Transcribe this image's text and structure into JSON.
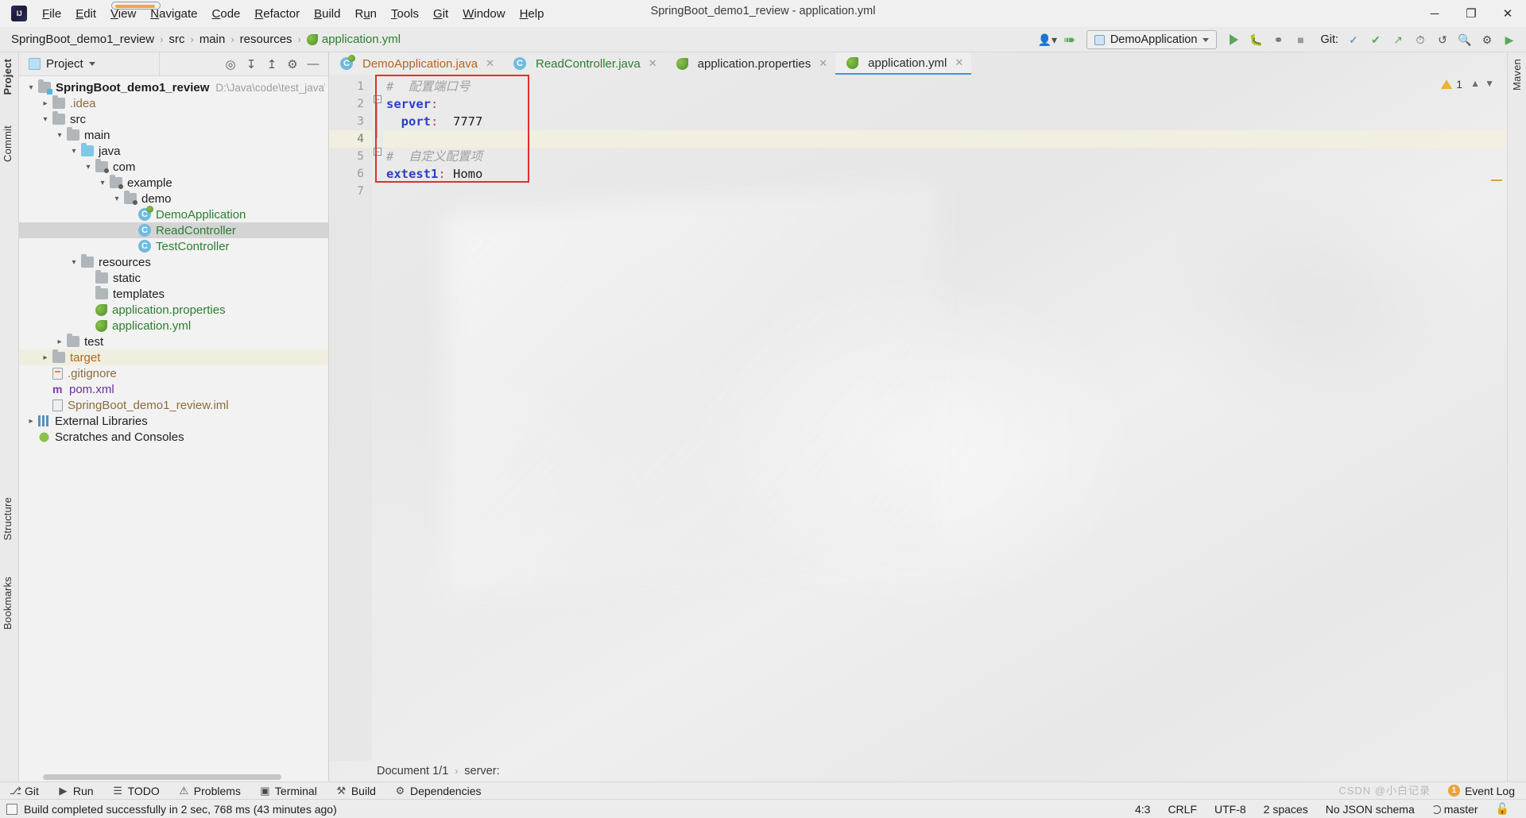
{
  "window": {
    "title": "SpringBoot_demo1_review - application.yml",
    "controls": {
      "minimize": "─",
      "maximize": "❐",
      "close": "✕"
    }
  },
  "menu": {
    "logo": "IJ",
    "items": [
      {
        "label": "File",
        "mnemonic": "F"
      },
      {
        "label": "Edit",
        "mnemonic": "E"
      },
      {
        "label": "View",
        "mnemonic": "V"
      },
      {
        "label": "Navigate",
        "mnemonic": "N",
        "highlighted": true
      },
      {
        "label": "Code",
        "mnemonic": "C"
      },
      {
        "label": "Refactor",
        "mnemonic": "R"
      },
      {
        "label": "Build",
        "mnemonic": "B"
      },
      {
        "label": "Run",
        "mnemonic": "u"
      },
      {
        "label": "Tools",
        "mnemonic": "T"
      },
      {
        "label": "Git",
        "mnemonic": "G"
      },
      {
        "label": "Window",
        "mnemonic": "W"
      },
      {
        "label": "Help",
        "mnemonic": "H"
      }
    ]
  },
  "navbar": {
    "crumbs": [
      "SpringBoot_demo1_review",
      "src",
      "main",
      "resources"
    ],
    "leaf": "application.yml",
    "separator": "›",
    "run_config": "DemoApplication",
    "git_label": "Git:",
    "icons": [
      "user-dropdown-icon",
      "update-project-icon",
      "run-icon",
      "debug-icon",
      "run-with-coverage-icon",
      "stop-icon",
      "git-commit-icon",
      "git-check-icon",
      "git-push-icon",
      "history-icon",
      "undo-icon",
      "search-icon",
      "settings-icon",
      "ide-icon"
    ]
  },
  "left_strip": {
    "tabs": [
      "Project",
      "Commit",
      "Structure",
      "Bookmarks"
    ],
    "selected": "Project"
  },
  "right_strip": {
    "tabs": [
      "Maven"
    ]
  },
  "project_panel": {
    "title": "Project",
    "actions": [
      "locate-icon",
      "expand-all-icon",
      "collapse-all-icon",
      "settings-icon",
      "hide-icon"
    ],
    "tree": [
      {
        "indent": 0,
        "arrow": "down",
        "icon": "module-folder",
        "label": "SpringBoot_demo1_review",
        "bold": true,
        "path": "D:\\Java\\code\\test_java\\SpringB…"
      },
      {
        "indent": 1,
        "arrow": "right",
        "icon": "folder",
        "label": ".idea",
        "color": "brown"
      },
      {
        "indent": 1,
        "arrow": "down",
        "icon": "folder",
        "label": "src"
      },
      {
        "indent": 2,
        "arrow": "down",
        "icon": "folder",
        "label": "main"
      },
      {
        "indent": 3,
        "arrow": "down",
        "icon": "folder-blue",
        "label": "java"
      },
      {
        "indent": 4,
        "arrow": "down",
        "icon": "package",
        "label": "com"
      },
      {
        "indent": 5,
        "arrow": "down",
        "icon": "package",
        "label": "example"
      },
      {
        "indent": 6,
        "arrow": "down",
        "icon": "package",
        "label": "demo"
      },
      {
        "indent": 7,
        "arrow": "none",
        "icon": "class-boot",
        "label": "DemoApplication",
        "color": "green"
      },
      {
        "indent": 7,
        "arrow": "none",
        "icon": "class",
        "label": "ReadController",
        "color": "green",
        "selected": true
      },
      {
        "indent": 7,
        "arrow": "none",
        "icon": "class",
        "label": "TestController",
        "color": "green"
      },
      {
        "indent": 3,
        "arrow": "down",
        "icon": "folder",
        "label": "resources"
      },
      {
        "indent": 4,
        "arrow": "none",
        "icon": "folder",
        "label": "static"
      },
      {
        "indent": 4,
        "arrow": "none",
        "icon": "folder",
        "label": "templates"
      },
      {
        "indent": 4,
        "arrow": "none",
        "icon": "spring-leaf",
        "label": "application.properties",
        "color": "green"
      },
      {
        "indent": 4,
        "arrow": "none",
        "icon": "spring-leaf",
        "label": "application.yml",
        "color": "green"
      },
      {
        "indent": 2,
        "arrow": "right",
        "icon": "folder",
        "label": "test"
      },
      {
        "indent": 1,
        "arrow": "right",
        "icon": "folder",
        "label": "target",
        "color": "orange",
        "highlighted": true
      },
      {
        "indent": 1,
        "arrow": "none",
        "icon": "file-git",
        "label": ".gitignore",
        "color": "brown"
      },
      {
        "indent": 1,
        "arrow": "none",
        "icon": "maven",
        "label": "pom.xml",
        "color": "purple"
      },
      {
        "indent": 1,
        "arrow": "none",
        "icon": "file",
        "label": "SpringBoot_demo1_review.iml",
        "color": "brown"
      },
      {
        "indent": 0,
        "arrow": "right",
        "icon": "libraries",
        "label": "External Libraries"
      },
      {
        "indent": 0,
        "arrow": "none",
        "icon": "scratches",
        "label": "Scratches and Consoles"
      }
    ]
  },
  "editor": {
    "tabs": [
      {
        "label": "DemoApplication.java",
        "icon": "spring-class-icon",
        "color": "orange",
        "active": false,
        "close": "✕"
      },
      {
        "label": "ReadController.java",
        "icon": "class-icon",
        "color": "green",
        "active": false,
        "close": "✕"
      },
      {
        "label": "application.properties",
        "icon": "spring-leaf-icon",
        "color": "dark",
        "active": false,
        "close": "✕"
      },
      {
        "label": "application.yml",
        "icon": "spring-leaf-icon",
        "color": "dark",
        "active": true,
        "close": "✕"
      }
    ],
    "gutter_numbers": [
      "1",
      "2",
      "3",
      "4",
      "5",
      "6",
      "7"
    ],
    "current_line": 4,
    "lines": [
      {
        "n": 1,
        "tokens": [
          {
            "t": "#  配置端口号",
            "c": "cmt"
          }
        ]
      },
      {
        "n": 2,
        "tokens": [
          {
            "t": "server",
            "c": "key"
          },
          {
            "t": ":",
            "c": "col"
          }
        ]
      },
      {
        "n": 3,
        "tokens": [
          {
            "t": "  ",
            "c": "val"
          },
          {
            "t": "port",
            "c": "key"
          },
          {
            "t": ":",
            "c": "col"
          },
          {
            "t": "  7777",
            "c": "num"
          }
        ]
      },
      {
        "n": 4,
        "tokens": [
          {
            "t": "",
            "c": "val"
          }
        ]
      },
      {
        "n": 5,
        "tokens": [
          {
            "t": "#  自定义配置项",
            "c": "cmt"
          }
        ]
      },
      {
        "n": 6,
        "tokens": [
          {
            "t": "extest1",
            "c": "key"
          },
          {
            "t": ":",
            "c": "col"
          },
          {
            "t": " Homo",
            "c": "val"
          }
        ]
      },
      {
        "n": 7,
        "tokens": [
          {
            "t": "",
            "c": "val"
          }
        ]
      }
    ],
    "warning_count": "1",
    "breadcrumb_left": "Document 1/1",
    "breadcrumb_right": "server:",
    "breadcrumb_sep": "›"
  },
  "bottom_bar": {
    "tools": [
      {
        "label": "Git",
        "glyph": "⎇",
        "name": "git"
      },
      {
        "label": "Run",
        "glyph": "▶",
        "name": "run"
      },
      {
        "label": "TODO",
        "glyph": "☰",
        "name": "todo"
      },
      {
        "label": "Problems",
        "glyph": "⚠",
        "name": "problems"
      },
      {
        "label": "Terminal",
        "glyph": "▣",
        "name": "terminal"
      },
      {
        "label": "Build",
        "glyph": "⚒",
        "name": "build"
      },
      {
        "label": "Dependencies",
        "glyph": "⚙",
        "name": "dependencies"
      }
    ],
    "event_log": {
      "label": "Event Log",
      "count": "1"
    }
  },
  "status_bar": {
    "message": "Build completed successfully in 2 sec, 768 ms (43 minutes ago)",
    "right_items": [
      "4:3",
      "CRLF",
      "UTF-8",
      "2 spaces",
      "No JSON schema"
    ],
    "branch": "master"
  },
  "watermark": "CSDN @小白记录",
  "colors": {
    "accent_blue": "#4a90d9",
    "green": "#2e7d32",
    "orange": "#b5651d",
    "purple": "#6a2fa0",
    "selection_red": "#e03030",
    "current_line": "#f2f0de"
  }
}
